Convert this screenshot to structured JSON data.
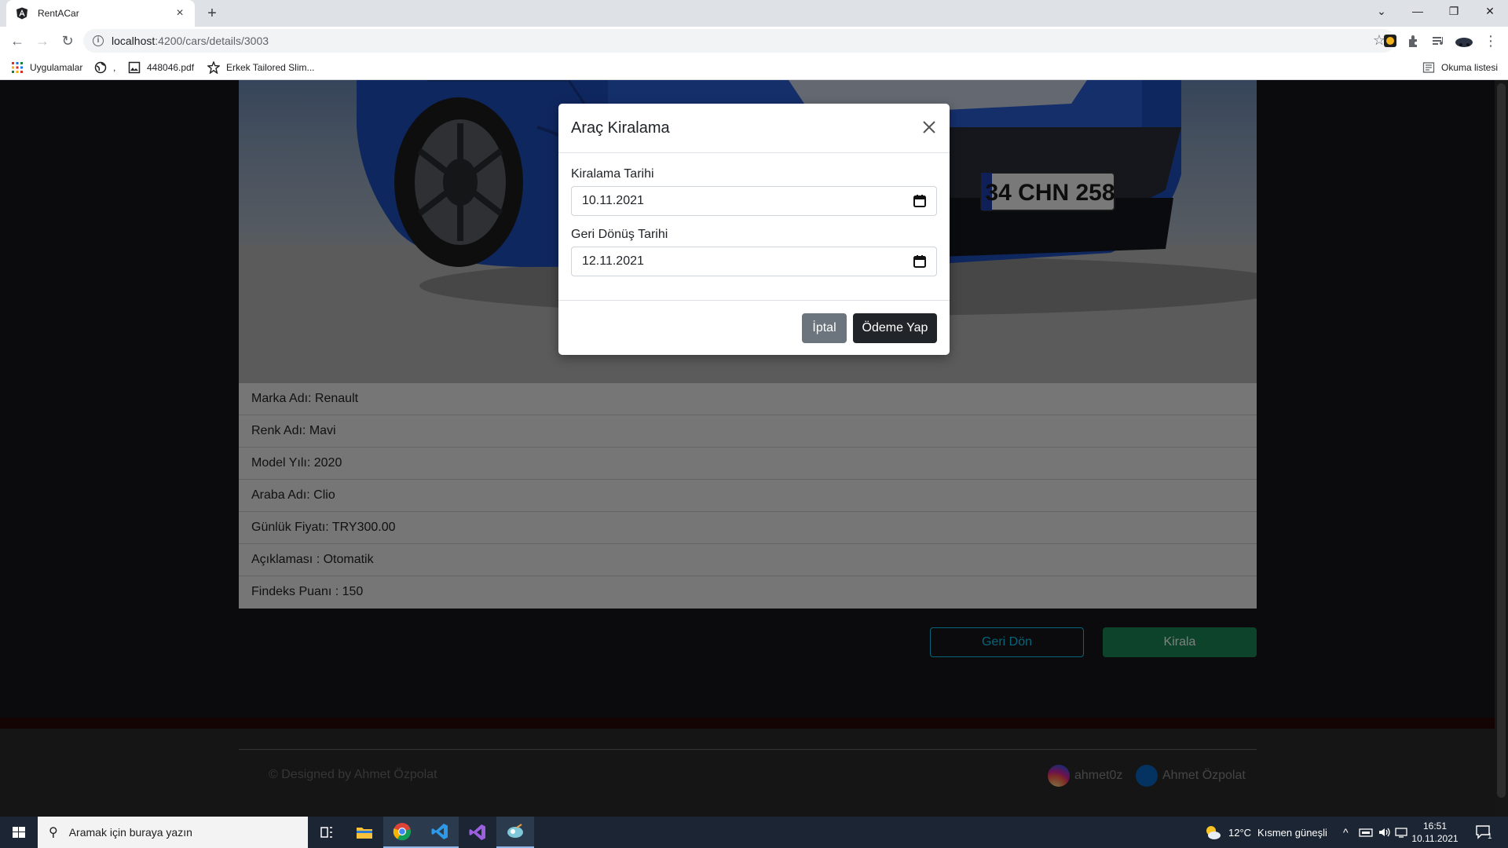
{
  "browser": {
    "tab_title": "RentACar",
    "tab_close": "×",
    "new_tab": "+",
    "url_host": "localhost",
    "url_path": ":4200/cars/details/3003",
    "reading_list": "Okuma listesi",
    "bookmarks": [
      {
        "label": "Uygulamalar",
        "icon": "apps-grid-icon"
      },
      {
        "label": ",",
        "icon": "globe-icon"
      },
      {
        "label": "448046.pdf",
        "icon": "image-file-icon"
      },
      {
        "label": "Erkek Tailored Slim...",
        "icon": "star-shape-icon"
      }
    ]
  },
  "car": {
    "plate": "34 CHN 258",
    "details": [
      "Marka Adı: Renault",
      "Renk Adı: Mavi",
      "Model Yılı: 2020",
      "Araba Adı: Clio",
      "Günlük Fiyatı: TRY300.00",
      "Açıklaması : Otomatik",
      "Findeks Puanı : 150"
    ],
    "back_button": "Geri Dön",
    "rent_button": "Kirala"
  },
  "footer": {
    "copyright": "© Designed by Ahmet Özpolat",
    "instagram": "ahmet0z",
    "linkedin": "Ahmet Özpolat"
  },
  "modal": {
    "title": "Araç Kiralama",
    "rent_date_label": "Kiralama Tarihi",
    "rent_date_value": "10.11.2021",
    "return_date_label": "Geri Dönüş Tarihi",
    "return_date_value": "12.11.2021",
    "cancel_button": "İptal",
    "pay_button": "Ödeme Yap"
  },
  "taskbar": {
    "search_placeholder": "Aramak için buraya yazın",
    "weather_temp": "12°C",
    "weather_desc": "Kısmen güneşli",
    "time": "16:51",
    "date": "10.11.2021",
    "notifications": "1"
  },
  "colors": {
    "accent_info": "#0dcaf0",
    "accent_success": "#198754",
    "modal_dark_button": "#212529",
    "car_body": "#1f4fbf"
  }
}
